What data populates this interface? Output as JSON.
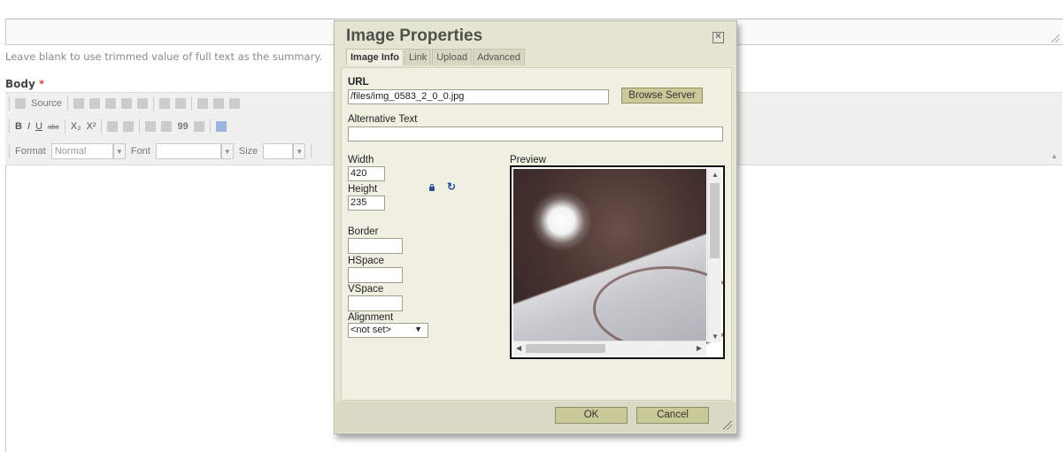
{
  "editor": {
    "summary_hint": "Leave blank to use trimmed value of full text as the summary.",
    "body_label": "Body",
    "required_mark": "*",
    "toolbar": {
      "source_label": "Source",
      "format_label": "Format",
      "format_value": "Normal",
      "font_label": "Font",
      "size_label": "Size"
    }
  },
  "dialog": {
    "title": "Image Properties",
    "tabs": [
      "Image Info",
      "Link",
      "Upload",
      "Advanced"
    ],
    "active_tab": "Image Info",
    "url_label": "URL",
    "url_value": "/files/img_0583_2_0_0.jpg",
    "browse_button": "Browse Server",
    "alt_label": "Alternative Text",
    "alt_value": "",
    "width_label": "Width",
    "width_value": "420",
    "height_label": "Height",
    "height_value": "235",
    "border_label": "Border",
    "hspace_label": "HSpace",
    "vspace_label": "VSpace",
    "alignment_label": "Alignment",
    "alignment_value": "<not set>",
    "preview_label": "Preview",
    "ok_button": "OK",
    "cancel_button": "Cancel",
    "icons": [
      "close-icon",
      "lock-ratio-icon",
      "reset-size-icon"
    ]
  }
}
